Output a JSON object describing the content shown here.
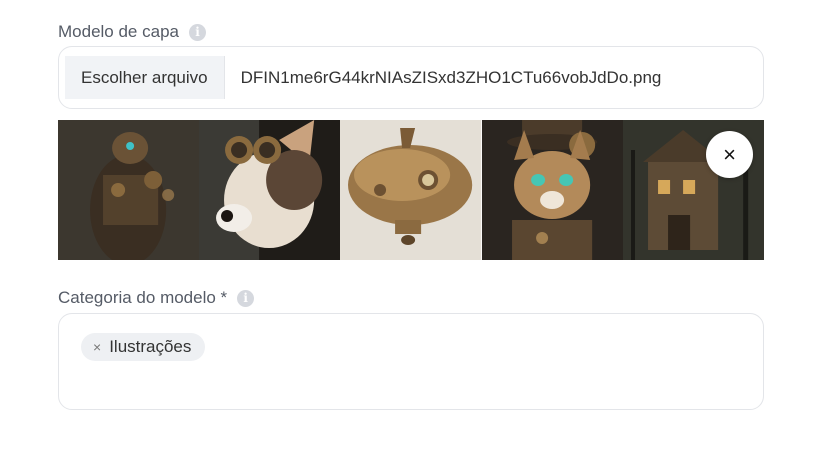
{
  "cover_field": {
    "label": "Modelo de capa",
    "info_icon": "info-icon",
    "choose_button_label": "Escolher arquivo",
    "file_name": "DFIN1me6rG44krNIAsZISxd3ZHO1CTu66vobJdDo.png",
    "remove_icon": "close-icon",
    "remove_glyph": "×"
  },
  "category_field": {
    "label": "Categoria do modelo *",
    "info_icon": "info-icon",
    "tags": [
      {
        "label": "Ilustrações",
        "remove_glyph": "×"
      }
    ]
  },
  "colors": {
    "label_text": "#555b66",
    "border": "#e3e5e9",
    "button_bg": "#f1f3f6",
    "chip_bg": "#eef0f3",
    "info_icon": "#d5d8de"
  }
}
